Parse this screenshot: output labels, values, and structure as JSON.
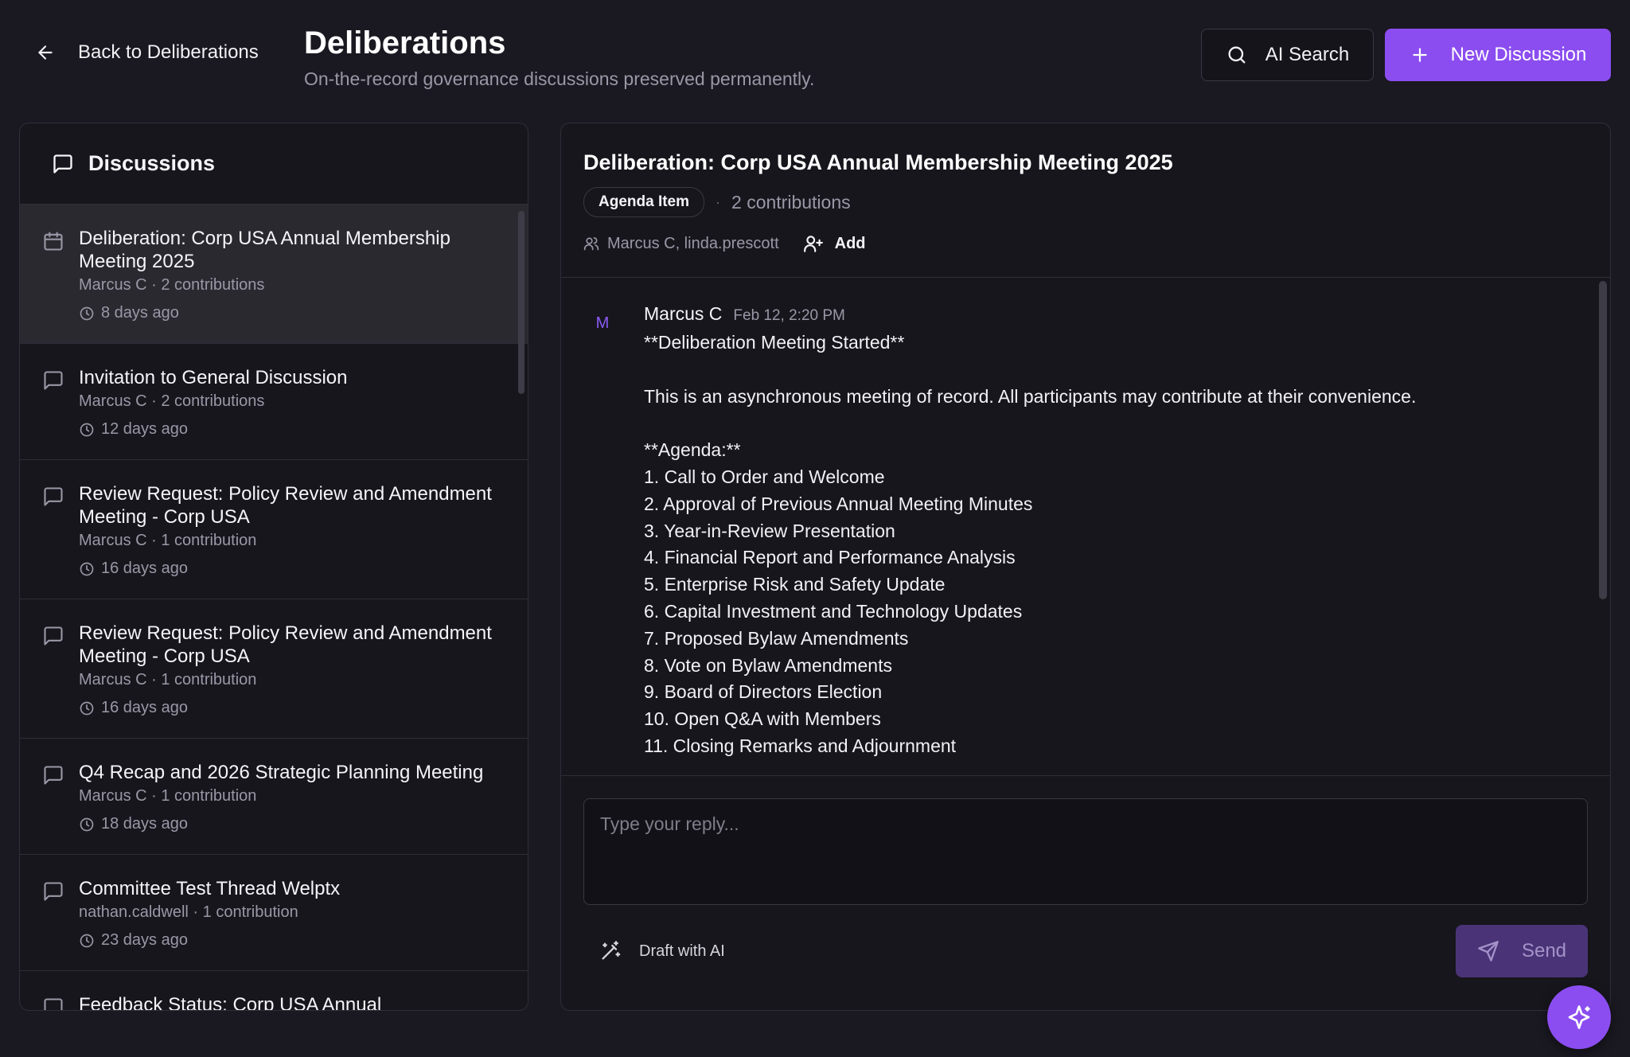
{
  "header": {
    "back_label": "Back to Deliberations",
    "title": "Deliberations",
    "subtitle": "On-the-record governance discussions preserved permanently.",
    "ai_search_label": "AI Search",
    "new_discussion_label": "New Discussion"
  },
  "sidebar": {
    "title": "Discussions",
    "items": [
      {
        "title": "Deliberation: Corp USA Annual Membership Meeting 2025",
        "meta": "Marcus C · 2 contributions",
        "time": "8 days ago",
        "icon": "calendar-icon",
        "active": true
      },
      {
        "title": "Invitation to General Discussion",
        "meta": "Marcus C · 2 contributions",
        "time": "12 days ago",
        "icon": "message-square-icon"
      },
      {
        "title": "Review Request: Policy Review and Amendment Meeting - Corp USA",
        "meta": "Marcus C · 1 contribution",
        "time": "16 days ago",
        "icon": "message-square-icon"
      },
      {
        "title": "Review Request: Policy Review and Amendment Meeting - Corp USA",
        "meta": "Marcus C · 1 contribution",
        "time": "16 days ago",
        "icon": "message-square-icon"
      },
      {
        "title": "Q4 Recap and 2026 Strategic Planning Meeting",
        "meta": "Marcus C · 1 contribution",
        "time": "18 days ago",
        "icon": "message-square-icon"
      },
      {
        "title": "Committee Test Thread Welptx",
        "meta": "nathan.caldwell · 1 contribution",
        "time": "23 days ago",
        "icon": "message-square-icon"
      },
      {
        "title": "Feedback Status: Corp USA Annual",
        "meta": "",
        "time": "",
        "icon": "message-square-icon"
      }
    ]
  },
  "thread": {
    "title": "Deliberation: Corp USA Annual Membership Meeting 2025",
    "tag": "Agenda Item",
    "separator": "·",
    "contributions": "2 contributions",
    "participants": "Marcus C, linda.prescott",
    "add_label": "Add"
  },
  "messages": [
    {
      "avatar": "M",
      "author": "Marcus C",
      "date": "Feb 12, 2:20 PM",
      "lines": [
        "**Deliberation Meeting Started**",
        "",
        "This is an asynchronous meeting of record. All participants may contribute at their convenience.",
        "",
        "**Agenda:**",
        "1. Call to Order and Welcome",
        "2. Approval of Previous Annual Meeting Minutes",
        "3. Year-in-Review Presentation",
        "4. Financial Report and Performance Analysis",
        "5. Enterprise Risk and Safety Update",
        "6. Capital Investment and Technology Updates",
        "7. Proposed Bylaw Amendments",
        "8. Vote on Bylaw Amendments",
        "9. Board of Directors Election",
        "10. Open Q&A with Members",
        "11. Closing Remarks and Adjournment"
      ]
    }
  ],
  "composer": {
    "placeholder": "Type your reply...",
    "draft_label": "Draft with AI",
    "send_label": "Send"
  },
  "colors": {
    "accent": "#8b4df0",
    "background": "#1a1820",
    "panel": "#17161d"
  }
}
